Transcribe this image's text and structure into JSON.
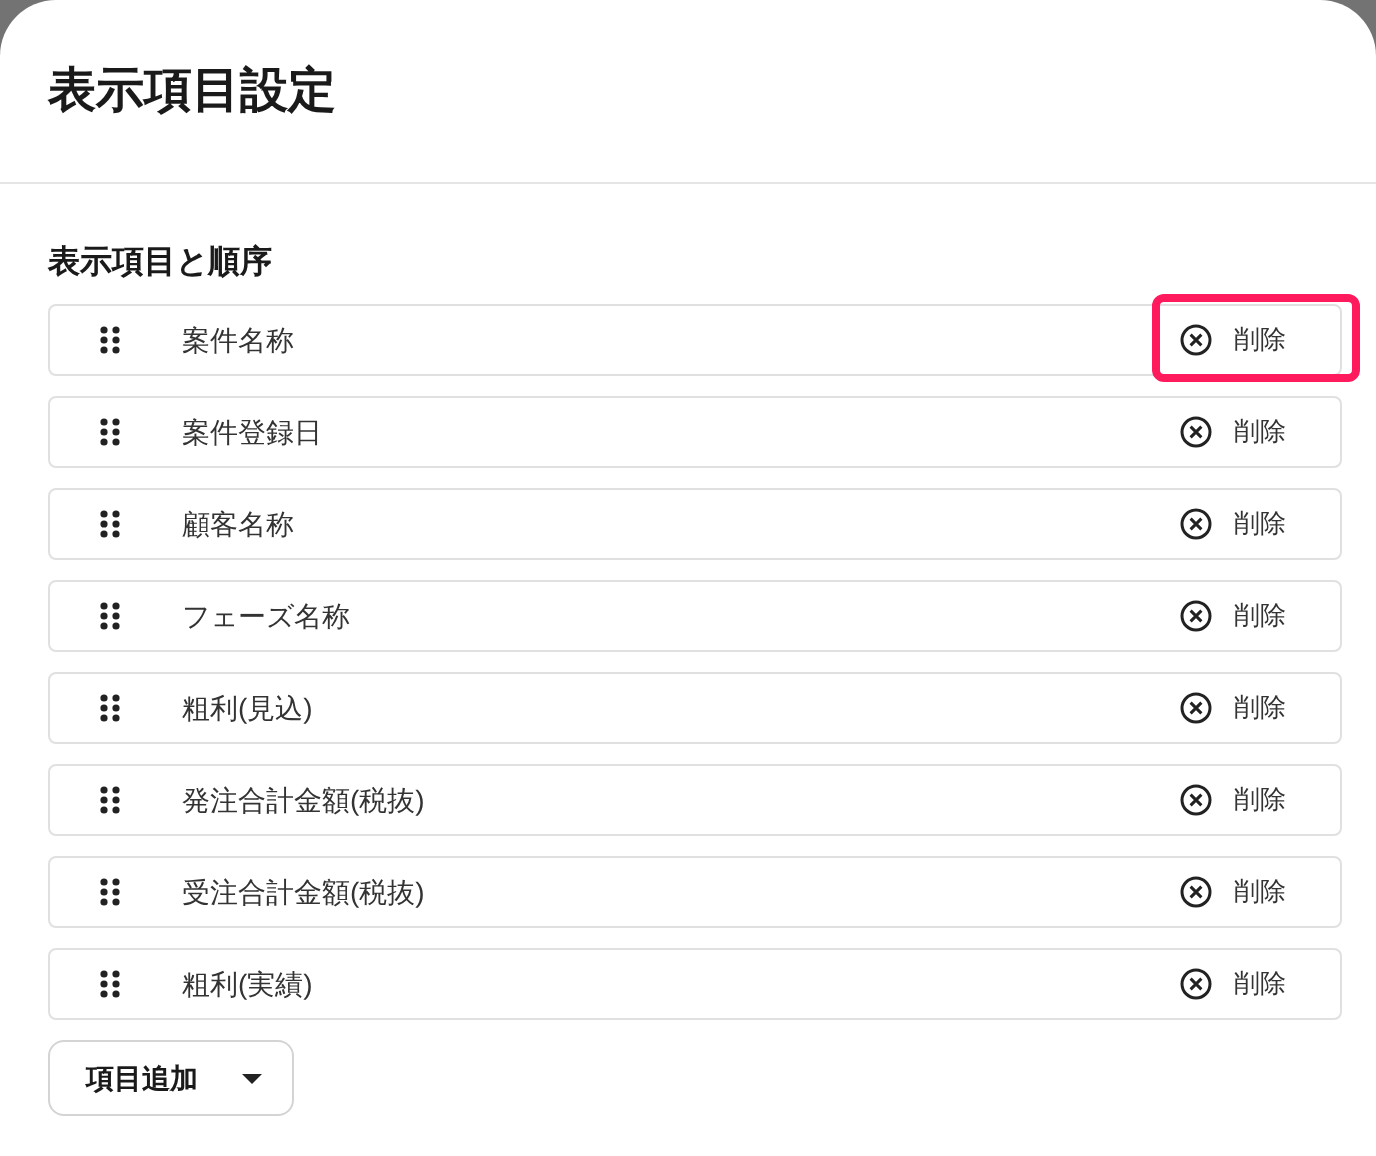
{
  "dialog": {
    "title": "表示項目設定"
  },
  "section": {
    "title": "表示項目と順序"
  },
  "items": [
    {
      "label": "案件名称",
      "delete_label": "削除",
      "highlighted": true
    },
    {
      "label": "案件登録日",
      "delete_label": "削除",
      "highlighted": false
    },
    {
      "label": "顧客名称",
      "delete_label": "削除",
      "highlighted": false
    },
    {
      "label": "フェーズ名称",
      "delete_label": "削除",
      "highlighted": false
    },
    {
      "label": "粗利(見込)",
      "delete_label": "削除",
      "highlighted": false
    },
    {
      "label": "発注合計金額(税抜)",
      "delete_label": "削除",
      "highlighted": false
    },
    {
      "label": "受注合計金額(税抜)",
      "delete_label": "削除",
      "highlighted": false
    },
    {
      "label": "粗利(実績)",
      "delete_label": "削除",
      "highlighted": false
    }
  ],
  "add_button": {
    "label": "項目追加"
  }
}
